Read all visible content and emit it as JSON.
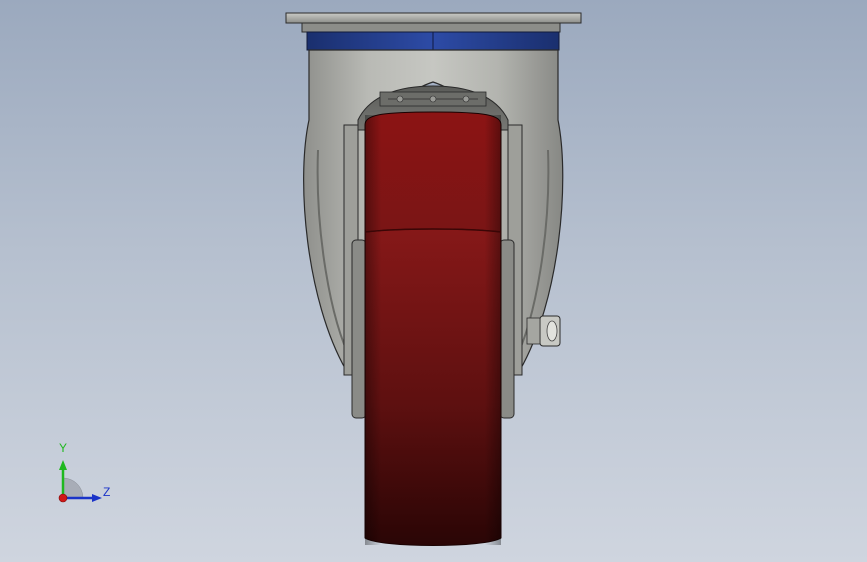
{
  "viewport": {
    "background_top": "#9ba9be",
    "background_bottom": "#cfd5df"
  },
  "model": {
    "subject": "caster-wheel",
    "wheel_color": "#8c1c1c",
    "bracket_color": "#a6a7a2",
    "bearing_ring_color": "#1f3b8c"
  },
  "triad": {
    "y_label": "Y",
    "z_label": "Z",
    "y_color": "#1fb81f",
    "z_color": "#1a33c8",
    "x_color": "#d01818"
  }
}
